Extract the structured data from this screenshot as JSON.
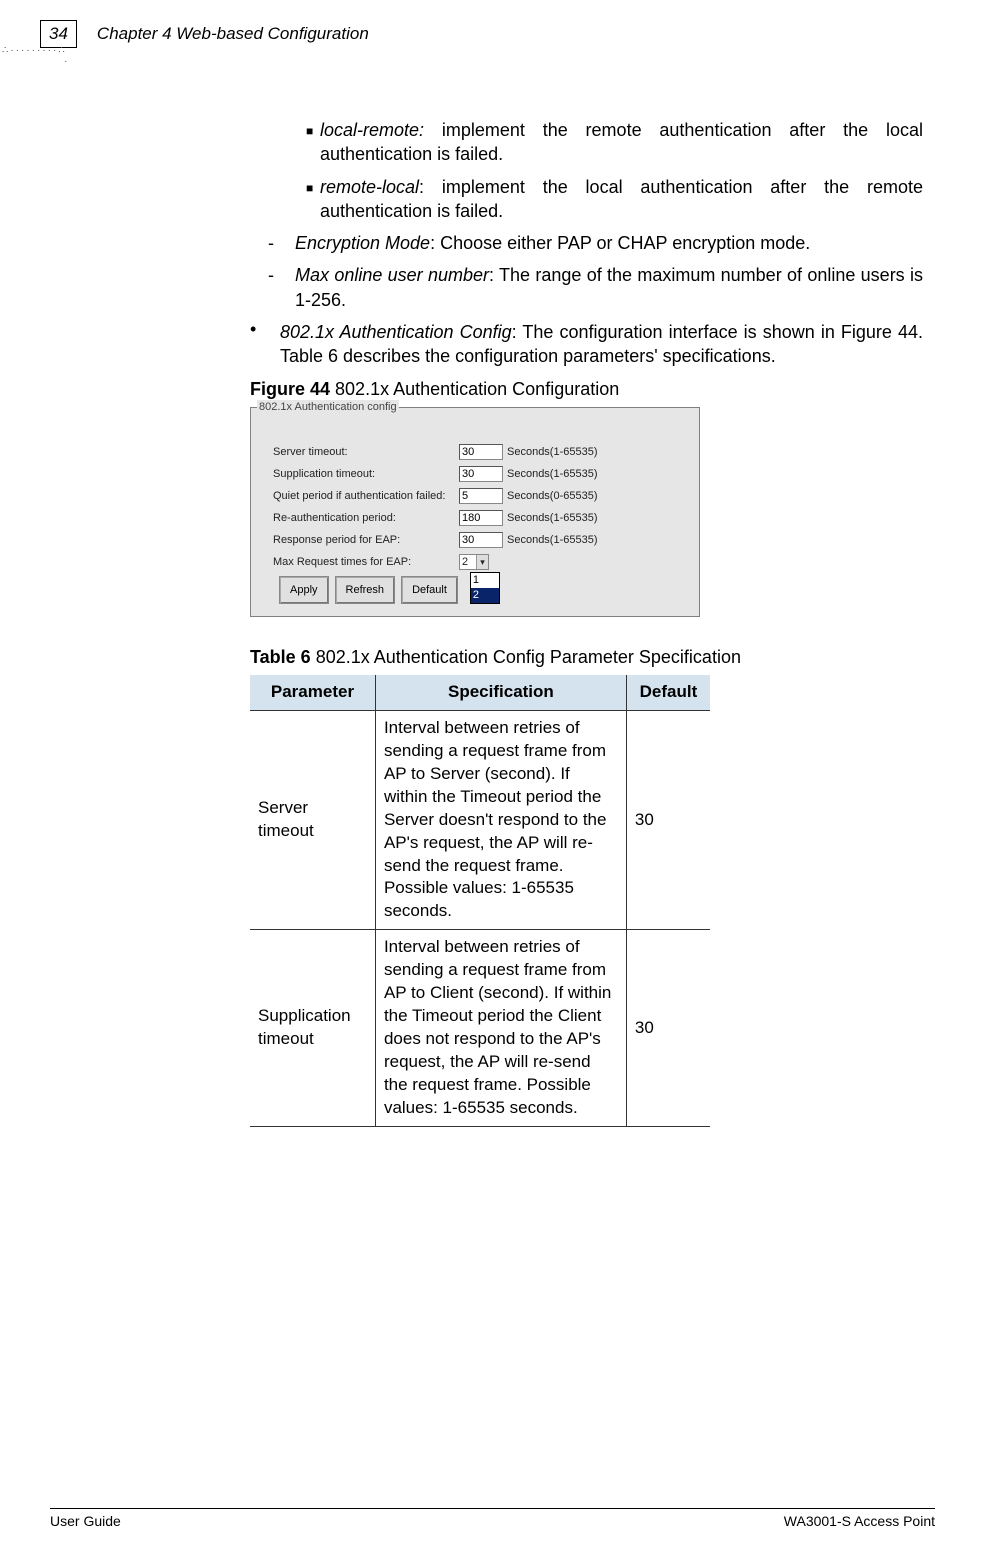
{
  "header": {
    "page_number": "34",
    "chapter": "Chapter 4 Web-based Configuration"
  },
  "bullets": {
    "local_remote_label": "local-remote:",
    "local_remote_text": " implement the remote authentication after the local authentication is failed.",
    "remote_local_label": "remote-local",
    "remote_local_text": ": implement the local authentication after the remote authentication is failed.",
    "encryption_label": "Encryption Mode",
    "encryption_text": ": Choose either PAP or CHAP encryption mode.",
    "max_user_label": "Max online user number",
    "max_user_text": ": The range of the maximum number of online users is 1-256.",
    "auth_config_label": "802.1x Authentication Config",
    "auth_config_text": ": The configuration interface is shown in Figure 44. Table 6 describes the configuration parameters' specifications."
  },
  "figure": {
    "caption_bold": "Figure 44",
    "caption_rest": " 802.1x Authentication Configuration",
    "legend": "802.1x Authentication config",
    "rows": [
      {
        "label": "Server timeout:",
        "value": "30",
        "range": "Seconds(1-65535)"
      },
      {
        "label": "Supplication timeout:",
        "value": "30",
        "range": "Seconds(1-65535)"
      },
      {
        "label": "Quiet period if authentication failed:",
        "value": "5",
        "range": "Seconds(0-65535)"
      },
      {
        "label": "Re-authentication period:",
        "value": "180",
        "range": "Seconds(1-65535)"
      },
      {
        "label": "Response period for EAP:",
        "value": "30",
        "range": "Seconds(1-65535)"
      }
    ],
    "max_request_label": "Max Request times for EAP:",
    "max_request_value": "2",
    "dropdown_options": [
      "1",
      "2"
    ],
    "buttons": {
      "apply": "Apply",
      "refresh": "Refresh",
      "defaultb": "Default"
    }
  },
  "table": {
    "caption_bold": "Table 6",
    "caption_rest": " 802.1x Authentication Config Parameter Specification",
    "headers": {
      "param": "Parameter",
      "spec": "Specification",
      "def": "Default"
    },
    "rows": [
      {
        "param": "Server timeout",
        "spec": "Interval between retries of sending a request frame from AP to Server (second). If within the Timeout period the Server doesn't respond to the AP's request, the AP will re-send the request frame. Possible values: 1-65535 seconds.",
        "def": "30"
      },
      {
        "param": "Supplication timeout",
        "spec": "Interval between retries of sending a request frame from AP to Client (second). If within the Timeout period the Client does not respond to the AP's request, the AP will re-send the request frame. Possible values: 1-65535 seconds.",
        "def": "30"
      }
    ]
  },
  "footer": {
    "left": "User Guide",
    "right": "WA3001-S Access Point"
  }
}
